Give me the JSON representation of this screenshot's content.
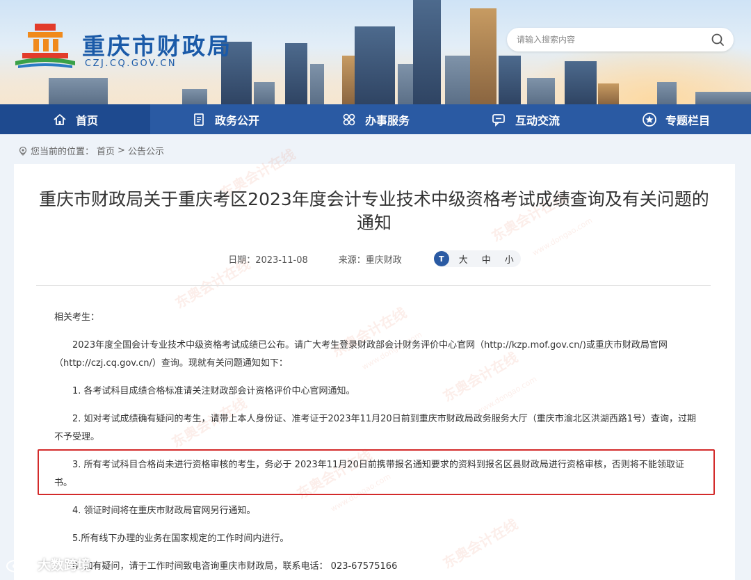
{
  "header": {
    "site_title": "重庆市财政局",
    "site_domain": "CZJ.CQ.GOV.CN",
    "search_placeholder": "请输入搜索内容",
    "colors": {
      "brand_blue": "#1a5aa8",
      "nav_bg": "#2a5aa3",
      "nav_active": "#1e4a8f",
      "highlight_red": "#d32a2a"
    }
  },
  "nav": {
    "items": [
      {
        "label": "首页",
        "icon": "home-icon"
      },
      {
        "label": "政务公开",
        "icon": "document-icon"
      },
      {
        "label": "办事服务",
        "icon": "service-icon"
      },
      {
        "label": "互动交流",
        "icon": "chat-icon"
      },
      {
        "label": "专题栏目",
        "icon": "star-icon"
      }
    ],
    "active_index": 0
  },
  "breadcrumb": {
    "prefix": "您当前的位置：",
    "home": "首页",
    "separator": ">",
    "current": "公告公示"
  },
  "article": {
    "title": "重庆市财政局关于重庆考区2023年度会计专业技术中级资格考试成绩查询及有关问题的通知",
    "date": "日期：2023-11-08",
    "source": "来源：重庆财政",
    "font_size": {
      "icon_label": "T",
      "large": "大",
      "medium": "中",
      "small": "小"
    },
    "greeting": "相关考生：",
    "intro": "2023年度全国会计专业技术中级资格考试成绩已公布。请广大考生登录财政部会计财务评价中心官网（http://kzp.mof.gov.cn/)或重庆市财政局官网（http://czj.cq.gov.cn/）查询。现就有关问题通知如下：",
    "items": [
      "1. 各考试科目成绩合格标准请关注财政部会计资格评价中心官网通知。",
      "2. 如对考试成绩确有疑问的考生，请带上本人身份证、准考证于2023年11月20日前到重庆市财政局政务服务大厅（重庆市渝北区洪湖西路1号）查询，过期不予受理。",
      "3. 所有考试科目合格尚未进行资格审核的考生，务必于 2023年11月20日前携带报名通知要求的资料到报名区县财政局进行资格审核，否则将不能领取证书。",
      "4. 领证时间将在重庆市财政局官网另行通知。",
      "5.所有线下办理的业务在国家规定的工作时间内进行。",
      "6. 如有疑问，请于工作时间致电咨询重庆市财政局，联系电话： 023-67575166"
    ]
  },
  "watermark": {
    "text": "东奥会计在线",
    "sub": "www.dongao.com"
  },
  "corner_mark": {
    "text": "大数跨境"
  }
}
